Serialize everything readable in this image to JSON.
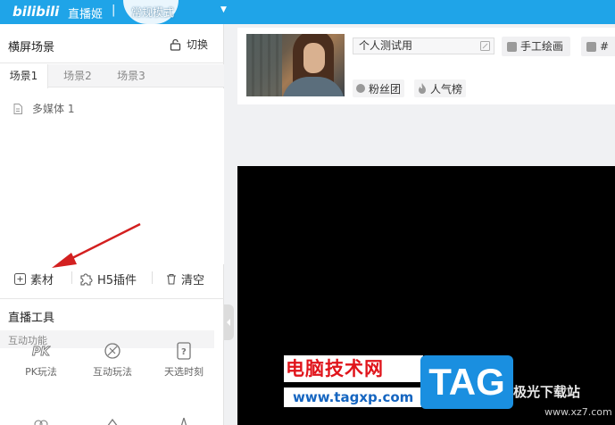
{
  "titlebar": {
    "logo": "bilibili",
    "app_name": "直播姬",
    "separator": "|",
    "mode": "常规模式"
  },
  "left_panel": {
    "title": "横屏场景",
    "switch_label": "切换",
    "tabs": [
      {
        "label": "场景1",
        "active": true
      },
      {
        "label": "场景2",
        "active": false
      },
      {
        "label": "场景3",
        "active": false
      }
    ],
    "sources": [
      {
        "label": "多媒体 1",
        "icon": "document-icon"
      }
    ],
    "actions": {
      "material": "素材",
      "h5_plugin": "H5插件",
      "clear": "清空"
    },
    "tools_title": "直播工具",
    "interaction_title": "互动功能",
    "tools": [
      {
        "label": "PK玩法",
        "icon": "pk-icon"
      },
      {
        "label": "互动玩法",
        "icon": "interactive-play-icon"
      },
      {
        "label": "天选时刻",
        "icon": "lucky-draw-icon"
      }
    ]
  },
  "info_card": {
    "room_title": "个人测试用",
    "category": "手工绘画",
    "extra_tag": "#",
    "chips": [
      {
        "label": "粉丝团",
        "icon": "fan-club-icon"
      },
      {
        "label": "人气榜",
        "icon": "flame-icon"
      }
    ]
  },
  "watermark": {
    "site_cn": "电脑技术网",
    "site_url": "www.tagxp.com",
    "logo_text": "TAG",
    "site2_cn": "极光下载站",
    "site2_url": "www.xz7.com"
  },
  "colors": {
    "titlebar": "#1fa4e8",
    "arrow": "#d32020",
    "watermark_red": "#e0141b",
    "watermark_blue": "#1a8fe0"
  }
}
